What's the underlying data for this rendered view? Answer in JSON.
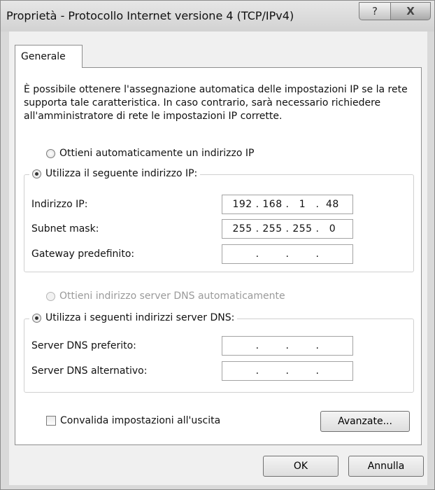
{
  "window": {
    "title": "Proprietà - Protocollo Internet versione 4 (TCP/IPv4)",
    "help_label": "?",
    "close_label": "X"
  },
  "tabs": [
    {
      "label": "Generale"
    }
  ],
  "intro_text": "È possibile ottenere l'assegnazione automatica delle impostazioni IP se la rete supporta tale caratteristica. In caso contrario, sarà necessario richiedere all'amministratore di rete le impostazioni IP corrette.",
  "ip": {
    "auto_option": "Ottieni automaticamente un indirizzo IP",
    "manual_option": "Utilizza il seguente indirizzo IP:",
    "selected": "manual",
    "fields": [
      {
        "label": "Indirizzo IP:",
        "octets": [
          "192",
          "168",
          "1",
          "48"
        ]
      },
      {
        "label": "Subnet mask:",
        "octets": [
          "255",
          "255",
          "255",
          "0"
        ]
      },
      {
        "label": "Gateway predefinito:",
        "octets": [
          "",
          "",
          "",
          ""
        ]
      }
    ]
  },
  "dns": {
    "auto_option": "Ottieni indirizzo server DNS automaticamente",
    "manual_option": "Utilizza i seguenti indirizzi server DNS:",
    "selected": "manual",
    "fields": [
      {
        "label": "Server DNS preferito:",
        "octets": [
          "",
          "",
          "",
          ""
        ]
      },
      {
        "label": "Server DNS alternativo:",
        "octets": [
          "",
          "",
          "",
          ""
        ]
      }
    ]
  },
  "validate_checkbox": {
    "label": "Convalida impostazioni all'uscita",
    "checked": false
  },
  "buttons": {
    "advanced": "Avanzate...",
    "ok": "OK",
    "cancel": "Annulla"
  }
}
